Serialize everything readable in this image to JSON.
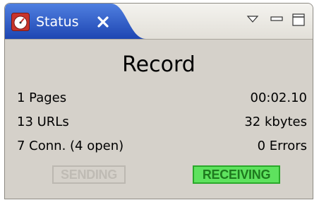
{
  "view": {
    "tab_label": "Status",
    "tab_icon": "speedometer-icon",
    "close_icon": "close-icon",
    "menu_icon": "view-menu-icon",
    "minimize_icon": "minimize-icon",
    "maximize_icon": "maximize-icon",
    "tab_color": "#2a58c8"
  },
  "status": {
    "title": "Record",
    "pages": "1 Pages",
    "elapsed": "00:02.10",
    "urls": "13 URLs",
    "size": "32 kbytes",
    "connections": "7 Conn. (4 open)",
    "errors": "0 Errors"
  },
  "indicators": {
    "sending": {
      "label": "SENDING",
      "active": false
    },
    "receiving": {
      "label": "RECEIVING",
      "active": true,
      "color": "#5ee25e"
    }
  }
}
